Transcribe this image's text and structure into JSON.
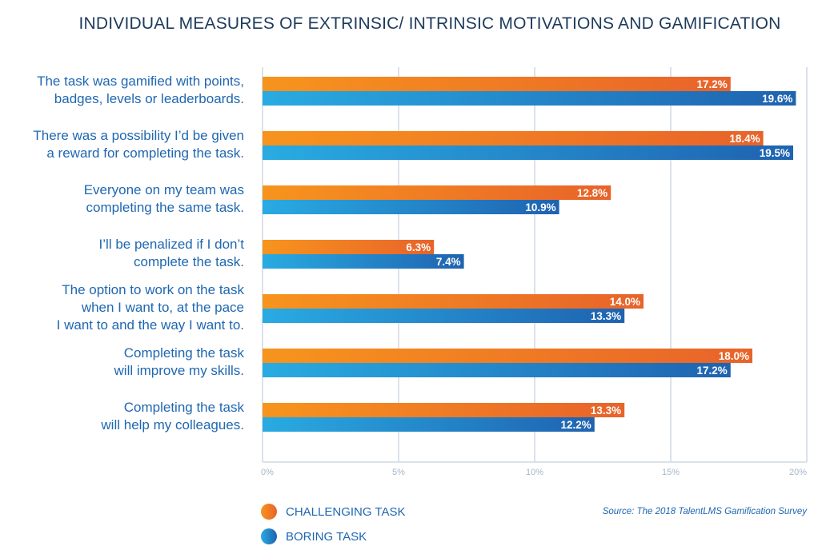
{
  "title": "INDIVIDUAL MEASURES OF EXTRINSIC/ INTRINSIC MOTIVATIONS AND GAMIFICATION",
  "source": "Source: The 2018 TalentLMS Gamification Survey",
  "colors": {
    "challenging_start": "#F7941D",
    "challenging_end": "#E8632A",
    "boring_start": "#29ABE2",
    "boring_end": "#1F63B0",
    "grid": "#cfd9e3",
    "label_text": "#1f67b1",
    "title_text": "#1d3a5c"
  },
  "legend": [
    {
      "name": "CHALLENGING TASK",
      "series": 0
    },
    {
      "name": "BORING TASK",
      "series": 1
    }
  ],
  "chart_data": {
    "type": "bar",
    "orientation": "horizontal",
    "title": "INDIVIDUAL MEASURES OF EXTRINSIC/ INTRINSIC MOTIVATIONS AND GAMIFICATION",
    "xlabel": "",
    "ylabel": "",
    "xlim": [
      0,
      20
    ],
    "xticks": [
      0,
      5,
      10,
      15,
      20
    ],
    "xtick_labels": [
      "0%",
      "5%",
      "10%",
      "15%",
      "20%"
    ],
    "grid": "vertical",
    "legend_position": "bottom-left",
    "categories": [
      "The task was gamified with points,\nbadges, levels or leaderboards.",
      "There was a possibility I’d be given\na reward for completing the task.",
      "Everyone on my team was\ncompleting the same task.",
      "I’ll be penalized if I don’t\ncomplete the task.",
      "The option to work on the task\nwhen I want to, at the pace\nI want to and the way I want to.",
      "Completing the task\nwill improve my skills.",
      "Completing the task\nwill help my colleagues."
    ],
    "series": [
      {
        "name": "CHALLENGING TASK",
        "values": [
          17.2,
          18.4,
          12.8,
          6.3,
          14.0,
          18.0,
          13.3
        ],
        "labels": [
          "17.2%",
          "18.4%",
          "12.8%",
          "6.3%",
          "14.0%",
          "18.0%",
          "13.3%"
        ]
      },
      {
        "name": "BORING TASK",
        "values": [
          19.6,
          19.5,
          10.9,
          7.4,
          13.3,
          17.2,
          12.2
        ],
        "labels": [
          "19.6%",
          "19.5%",
          "10.9%",
          "7.4%",
          "13.3%",
          "17.2%",
          "12.2%"
        ]
      }
    ]
  }
}
